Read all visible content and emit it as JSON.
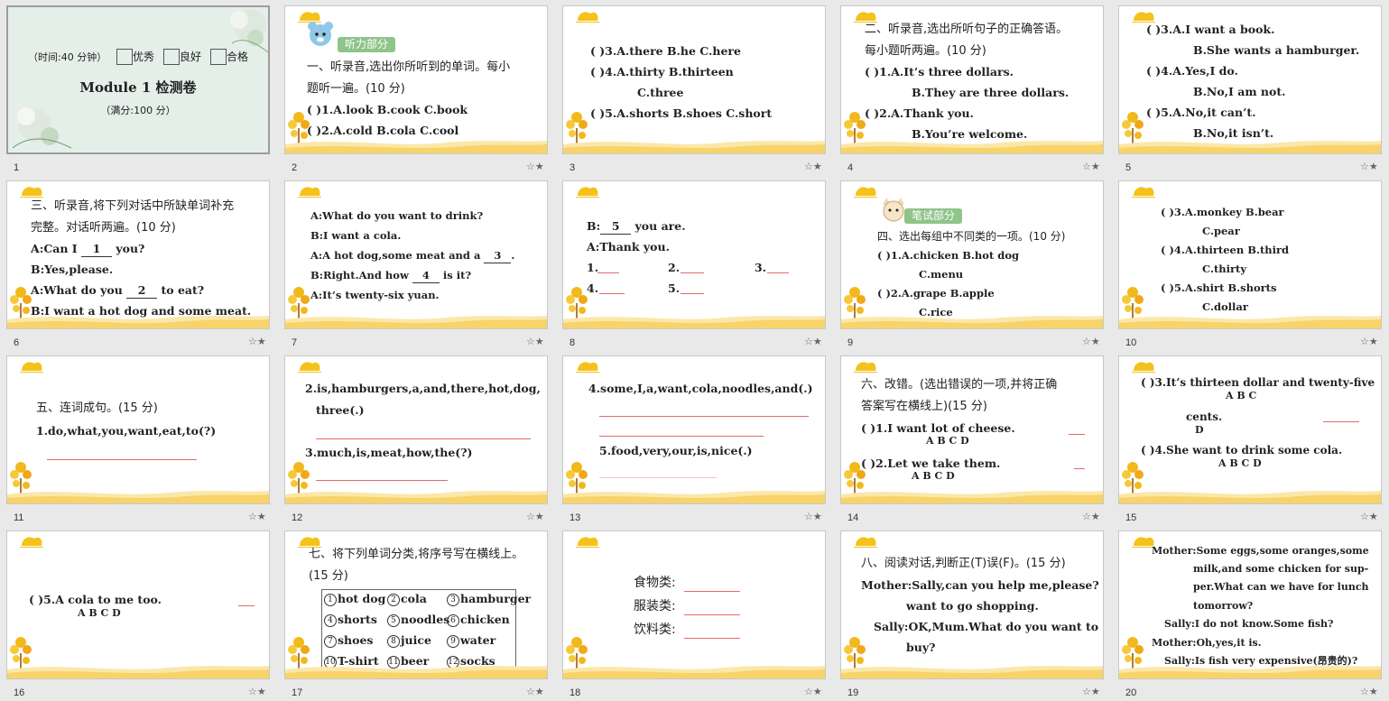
{
  "title_slide": {
    "time": "（时间:40 分钟）",
    "r1": "优秀",
    "r2": "良好",
    "r3": "合格",
    "title": "Module 1 检测卷",
    "score": "（满分:100 分）"
  },
  "s2": {
    "tag": "听力部分",
    "l1": "一、听录音,选出你所听到的单词。每小",
    "l2": "题听一遍。(10 分)",
    "l3": "(      )1.A.look          B.cook        C.book",
    "l4": "(      )2.A.cold          B.cola         C.cool"
  },
  "s3": {
    "l1": "(      )3.A.there       B.he           C.here",
    "l2": "(      )4.A.thirty              B.thirteen",
    "l3": "C.three",
    "l4": "(      )5.A.shorts     B.shoes       C.short"
  },
  "s4": {
    "l1": "二、听录音,选出所听句子的正确答语。",
    "l2": "每小题听两遍。(10 分)",
    "l3": "(      )1.A.It’s three dollars.",
    "l4": "B.They are three dollars.",
    "l5": "(      )2.A.Thank you.",
    "l6": "B.You’re welcome."
  },
  "s5": {
    "l1": "(      )3.A.I want a book.",
    "l2": "B.She wants a hamburger.",
    "l3": "(      )4.A.Yes,I do.",
    "l4": "B.No,I am not.",
    "l5": "(      )5.A.No,it can’t.",
    "l6": "B.No,it isn’t."
  },
  "s6": {
    "l1": "三、听录音,将下列对话中所缺单词补充",
    "l2": "完整。对话听两遍。(10 分)",
    "l3a": "A:Can I ",
    "l3b": "1",
    "l3c": " you?",
    "l4": "B:Yes,please.",
    "l5a": "A:What do you ",
    "l5b": "2",
    "l5c": " to eat?",
    "l6": "B:I want a hot dog and some meat."
  },
  "s7": {
    "l1": "A:What do you want to drink?",
    "l2": "B:I want a cola.",
    "l3a": "A:A hot dog,some meat and a ",
    "l3b": "3",
    "l3c": ".",
    "l4a": "B:Right.And how ",
    "l4b": "4",
    "l4c": " is it?",
    "l5": "A:It’s twenty-six yuan."
  },
  "s8": {
    "l1a": "B:",
    "l1b": "5",
    "l1c": " you are.",
    "l2": "A:Thank you.",
    "n1": "1.",
    "n2": "2.",
    "n3": "3.",
    "n4": "4.",
    "n5": "5."
  },
  "s9": {
    "tag": "笔试部分",
    "l1": "四、选出每组中不同类的一项。(10 分)",
    "l2": "(      )1.A.chicken          B.hot dog",
    "l3": "C.menu",
    "l4": "(      )2.A.grape             B.apple",
    "l5": "C.rice"
  },
  "s10": {
    "l1": "(      )3.A.monkey           B.bear",
    "l2": "C.pear",
    "l3": "(      )4.A.thirteen          B.third",
    "l4": "C.thirty",
    "l5": "(      )5.A.shirt               B.shorts",
    "l6": "C.dollar"
  },
  "s11": {
    "l1": "五、连词成句。(15 分)",
    "l2": "1.do,what,you,want,eat,to(?)"
  },
  "s12": {
    "l1": "2.is,hamburgers,a,and,there,hot,dog,",
    "l2": "three(.)",
    "l3": "3.much,is,meat,how,the(?)"
  },
  "s13": {
    "l1": "4.some,I,a,want,cola,noodles,and(.)",
    "l2": "5.food,very,our,is,nice(.)"
  },
  "s14": {
    "l1": "六、改错。(选出错误的一项,并将正确",
    "l2": "答案写在横线上)(15 分)",
    "q1": "(      )1.I want lot of cheese.",
    "q1abcd": "A    B   C     D",
    "q2": "(      )2.Let we take them.",
    "q2abcd": "A    B    C       D"
  },
  "s15": {
    "q3": "(      )3.It’s thirteen dollar and twenty-five",
    "q3abc": "A           B        C",
    "q3b": "cents.",
    "q3d": "D",
    "q4": "(      )4.She want to drink some cola.",
    "q4abcd": "A          B        C       D"
  },
  "s16": {
    "q5": "(      )5.A cola to me too.",
    "q5abcd": "A    B    C    D"
  },
  "s17": {
    "l1": "七、将下列单词分类,将序号写在横线上。",
    "l2": "(15 分)",
    "words": [
      [
        "1",
        "hot dog"
      ],
      [
        "2",
        "cola"
      ],
      [
        "3",
        "hamburger"
      ],
      [
        "4",
        "shorts"
      ],
      [
        "5",
        "noodles"
      ],
      [
        "6",
        "chicken"
      ],
      [
        "7",
        "shoes"
      ],
      [
        "8",
        "juice"
      ],
      [
        "9",
        "water"
      ],
      [
        "10",
        "T-shirt"
      ],
      [
        "11",
        "beer"
      ],
      [
        "12",
        "socks"
      ]
    ]
  },
  "s18": {
    "c1": "食物类:",
    "c2": "服装类:",
    "c3": "饮料类:"
  },
  "s19": {
    "l1": "八、阅读对话,判断正(T)误(F)。(15 分)",
    "l2": "Mother:Sally,can you help me,please? I",
    "l3": "want to go shopping.",
    "l4": "Sally:OK,Mum.What do you want to",
    "l5": "buy?"
  },
  "s20": {
    "l1": "Mother:Some eggs,some oranges,some",
    "l2": "milk,and some chicken for sup-",
    "l3": "per.What can we have for lunch",
    "l4": "tomorrow?",
    "l5": "Sally:I do not know.Some fish?",
    "l6": "Mother:Oh,yes,it is.",
    "l7": "Sally:Is fish very expensive(昂贵的)?"
  },
  "slide_numbers": [
    "1",
    "2",
    "3",
    "4",
    "5",
    "6",
    "7",
    "8",
    "9",
    "10",
    "11",
    "12",
    "13",
    "14",
    "15",
    "16",
    "17",
    "18",
    "19",
    "20"
  ],
  "star": "☆★"
}
